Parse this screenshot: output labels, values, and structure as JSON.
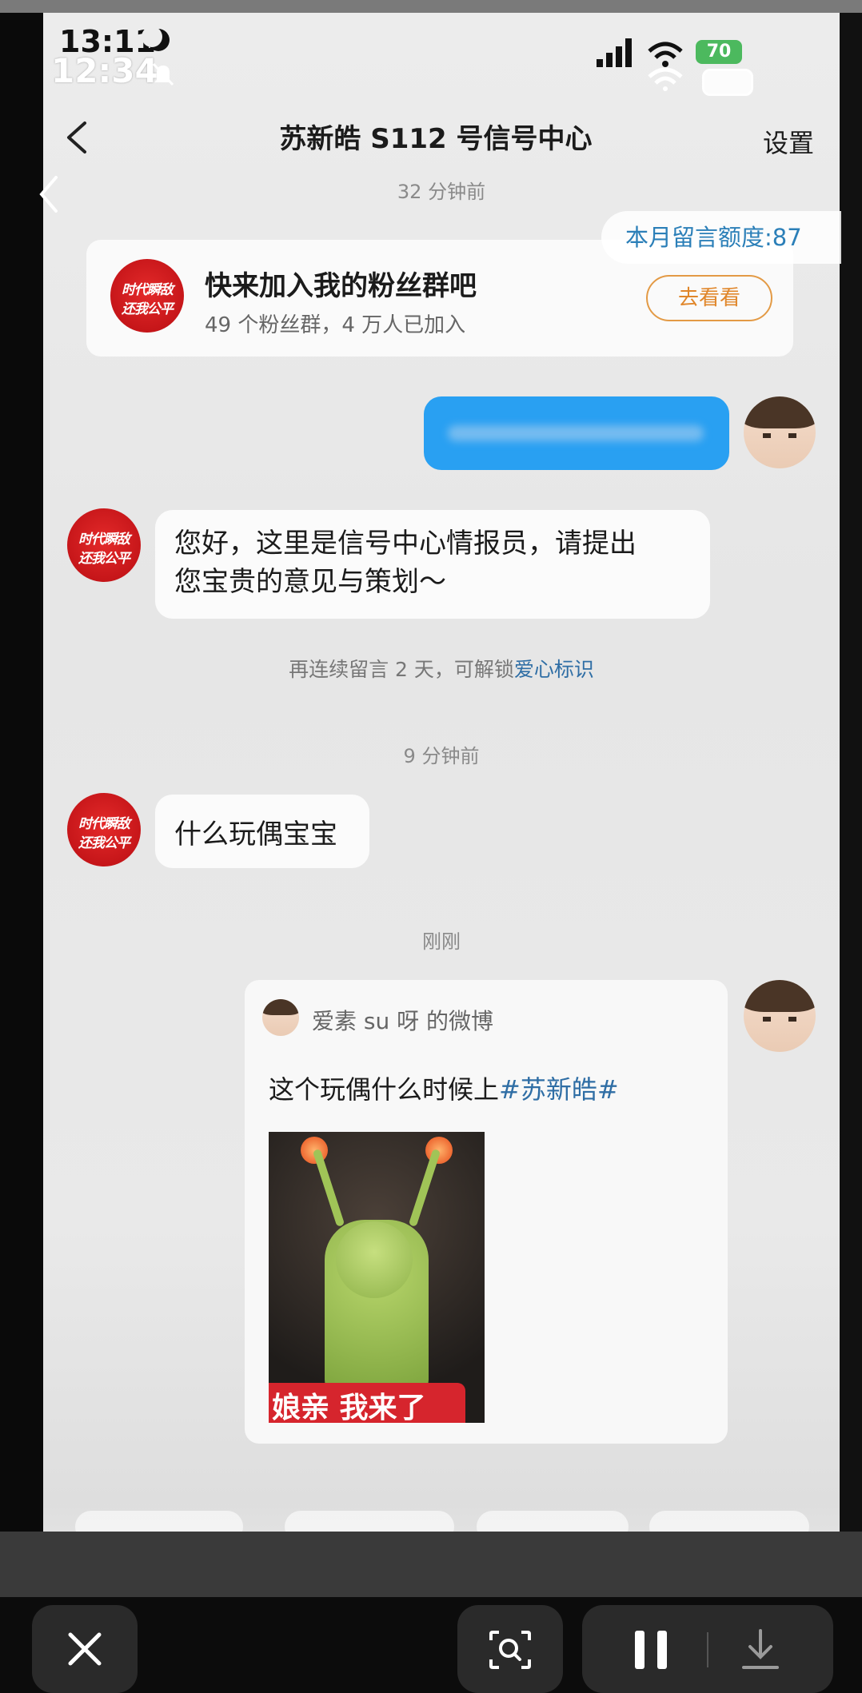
{
  "status_bar": {
    "time_primary": "13:11",
    "time_secondary": "12:34",
    "battery_percent": "70"
  },
  "nav": {
    "title": "苏新皓 S112 号信号中心",
    "settings_label": "设置"
  },
  "timestamps": {
    "first": "32 分钟前",
    "second": "9 分钟前",
    "third": "刚刚"
  },
  "quota": {
    "label": "本月留言额度:87"
  },
  "fan_group_card": {
    "logo_line1": "时代瞬敌",
    "logo_line2": "还我公平",
    "title": "快来加入我的粉丝群吧",
    "subtitle": "49 个粉丝群，4 万人已加入",
    "button_label": "去看看"
  },
  "messages": {
    "m1_line1": "您好，这里是信号中心情报员，请提出",
    "m1_line2": "您宝贵的意见与策划～",
    "m2": "什么玩偶宝宝"
  },
  "hint": {
    "prefix": "再连续留言 2 天，可解锁",
    "link": "爱心标识"
  },
  "weibo_card": {
    "source": "爱素 su 呀 的微博",
    "text_prefix": "这个玩偶什么时候上",
    "hashtag": "#苏新皓#",
    "image_caption": "娘亲 我来了"
  },
  "colors": {
    "accent_blue": "#2f6ea5",
    "bubble_blue": "#29a0f2",
    "button_orange": "#e0862a",
    "logo_red": "#d81e25"
  }
}
